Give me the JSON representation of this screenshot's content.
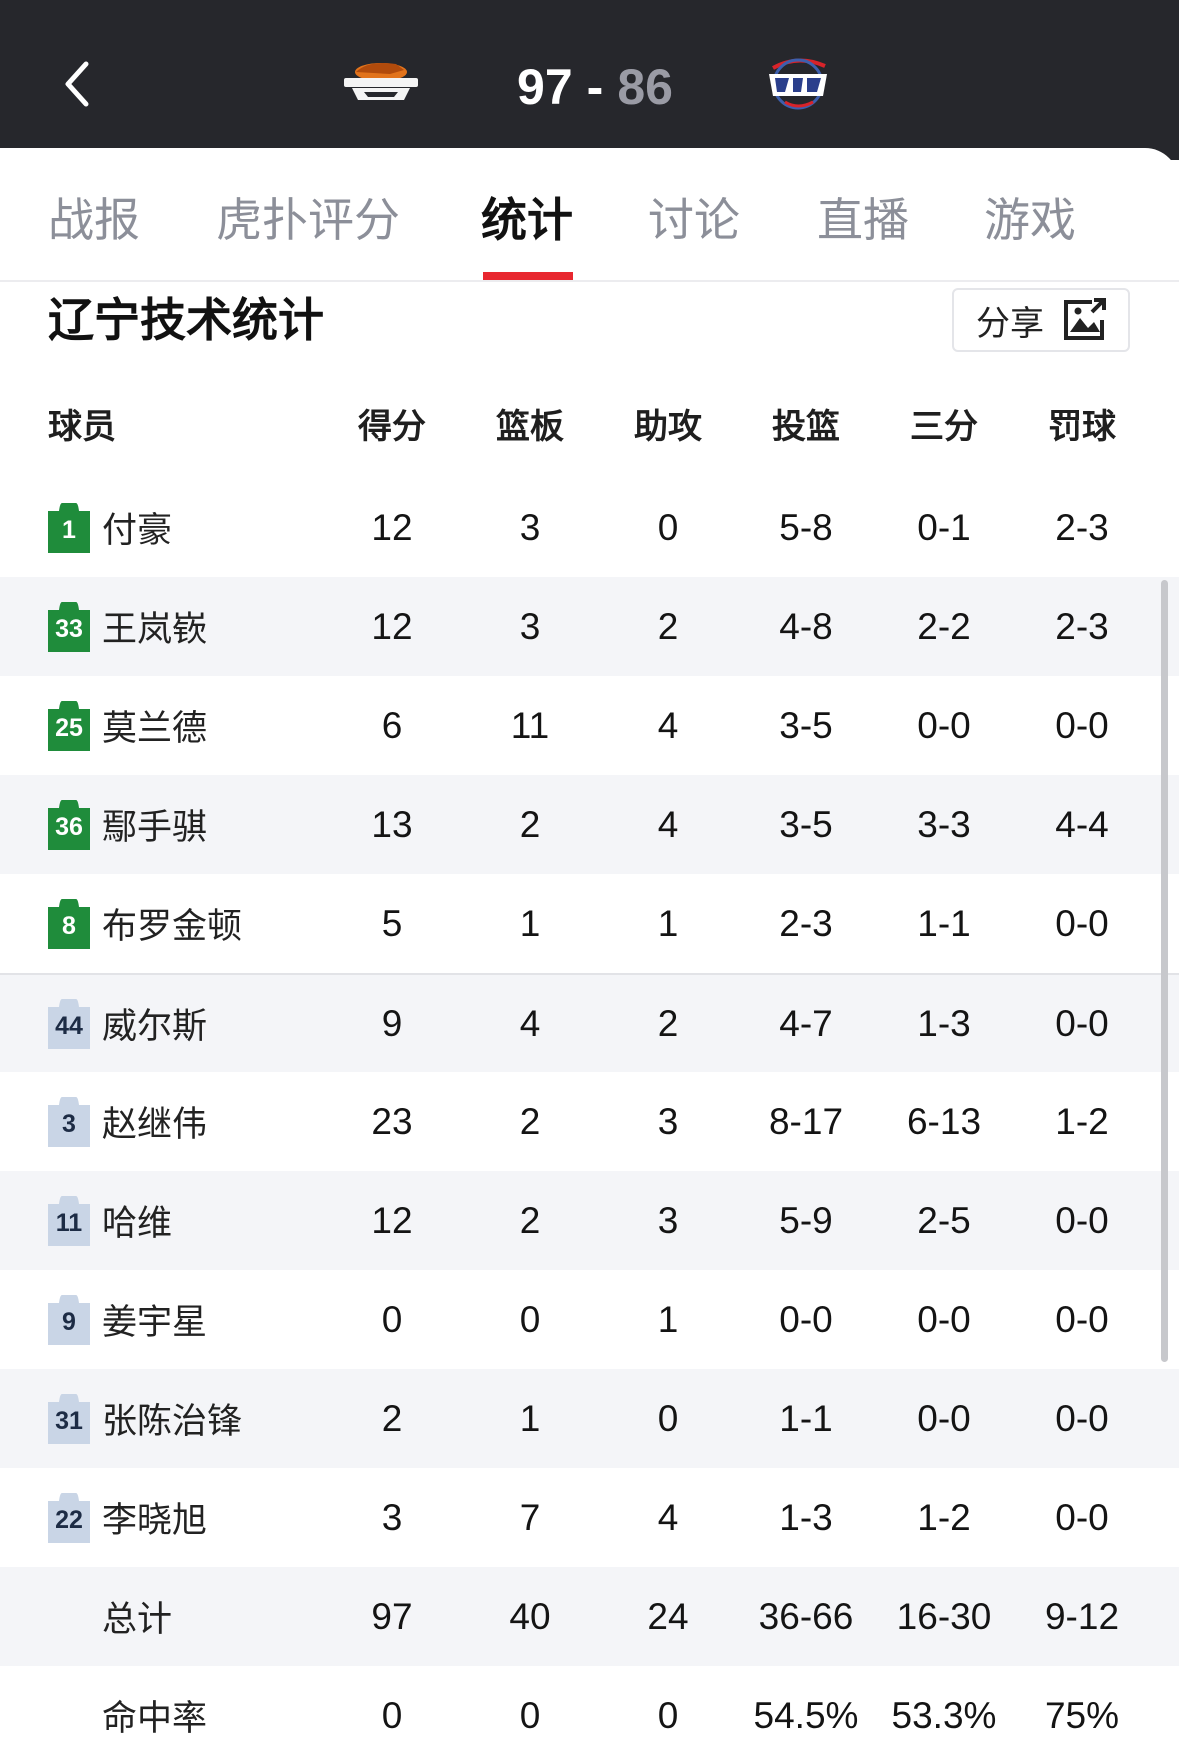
{
  "header": {
    "home_team_logo": "liaoning-team-logo",
    "away_team_logo": "guangzhou-loong-lions-team-logo",
    "home_score": "97",
    "separator": "-",
    "away_score": "86",
    "colors": {
      "background": "#26272c",
      "home_score": "#ffffff",
      "away_score": "#9a9ba5"
    }
  },
  "tabs": [
    {
      "label": "战报",
      "active": false
    },
    {
      "label": "虎扑评分",
      "active": false
    },
    {
      "label": "统计",
      "active": true
    },
    {
      "label": "讨论",
      "active": false
    },
    {
      "label": "直播",
      "active": false
    },
    {
      "label": "游戏",
      "active": false
    }
  ],
  "accent_color": "#e8272f",
  "section": {
    "title": "辽宁技术统计",
    "share_label": "分享",
    "share_icon": "image-share-icon"
  },
  "table": {
    "columns": [
      "球员",
      "得分",
      "篮板",
      "助攻",
      "投篮",
      "三分",
      "罚球"
    ],
    "starters": [
      {
        "number": "1",
        "name": "付豪",
        "stats": [
          "12",
          "3",
          "0",
          "5-8",
          "0-1",
          "2-3"
        ]
      },
      {
        "number": "33",
        "name": "王岚嵚",
        "stats": [
          "12",
          "3",
          "2",
          "4-8",
          "2-2",
          "2-3"
        ]
      },
      {
        "number": "25",
        "name": "莫兰德",
        "stats": [
          "6",
          "11",
          "4",
          "3-5",
          "0-0",
          "0-0"
        ]
      },
      {
        "number": "36",
        "name": "鄢手骐",
        "stats": [
          "13",
          "2",
          "4",
          "3-5",
          "3-3",
          "4-4"
        ]
      },
      {
        "number": "8",
        "name": "布罗金顿",
        "stats": [
          "5",
          "1",
          "1",
          "2-3",
          "1-1",
          "0-0"
        ]
      }
    ],
    "bench": [
      {
        "number": "44",
        "name": "威尔斯",
        "stats": [
          "9",
          "4",
          "2",
          "4-7",
          "1-3",
          "0-0"
        ]
      },
      {
        "number": "3",
        "name": "赵继伟",
        "stats": [
          "23",
          "2",
          "3",
          "8-17",
          "6-13",
          "1-2"
        ]
      },
      {
        "number": "11",
        "name": "哈维",
        "stats": [
          "12",
          "2",
          "3",
          "5-9",
          "2-5",
          "0-0"
        ]
      },
      {
        "number": "9",
        "name": "姜宇星",
        "stats": [
          "0",
          "0",
          "1",
          "0-0",
          "0-0",
          "0-0"
        ]
      },
      {
        "number": "31",
        "name": "张陈治锋",
        "stats": [
          "2",
          "1",
          "0",
          "1-1",
          "0-0",
          "0-0"
        ]
      },
      {
        "number": "22",
        "name": "李晓旭",
        "stats": [
          "3",
          "7",
          "4",
          "1-3",
          "1-2",
          "0-0"
        ]
      }
    ],
    "totals": {
      "label": "总计",
      "stats": [
        "97",
        "40",
        "24",
        "36-66",
        "16-30",
        "9-12"
      ]
    },
    "percentages": {
      "label": "命中率",
      "stats": [
        "0",
        "0",
        "0",
        "54.5%",
        "53.3%",
        "75%"
      ]
    },
    "jersey_colors": {
      "starter": "#1f8c3b",
      "bench": "#c9d5e6"
    }
  }
}
